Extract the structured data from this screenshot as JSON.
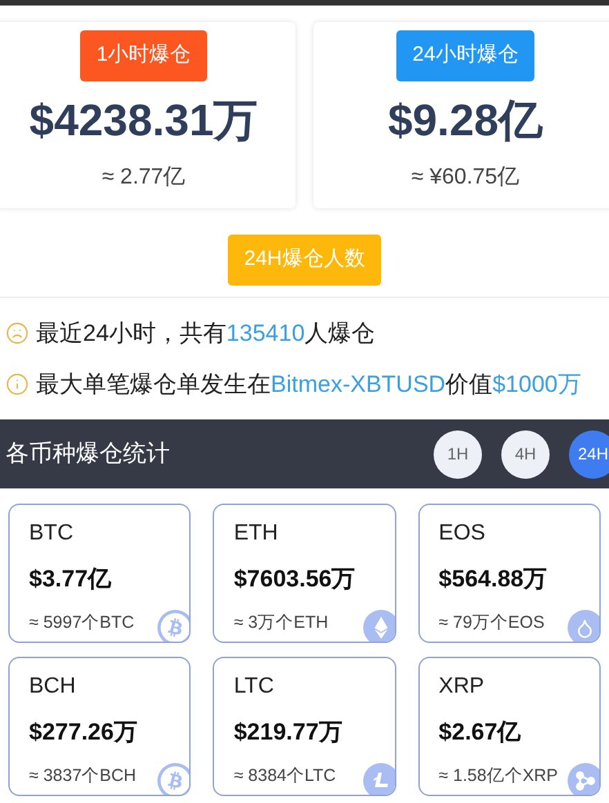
{
  "summary_cards": [
    {
      "label": "1小时爆仓",
      "color": "#fc5621",
      "value": "$4238.31万",
      "approx": "≈ 2.77亿"
    },
    {
      "label": "24小时爆仓",
      "color": "#2196f3",
      "value": "$9.28亿",
      "approx": "≈ ¥60.75亿"
    }
  ],
  "people_button": {
    "label": "24H爆仓人数"
  },
  "info_lines": [
    {
      "kind": "sad",
      "segments": [
        {
          "text": "最近24小时，共有",
          "highlight": false
        },
        {
          "text": "135410",
          "highlight": true
        },
        {
          "text": "人爆仓",
          "highlight": false
        }
      ]
    },
    {
      "kind": "info",
      "segments": [
        {
          "text": "最大单笔爆仓单发生在",
          "highlight": false
        },
        {
          "text": "Bitmex-XBTUSD",
          "highlight": true
        },
        {
          "text": "价值",
          "highlight": false
        },
        {
          "text": "$1000万",
          "highlight": true
        }
      ]
    }
  ],
  "section": {
    "title": "各币种爆仓统计",
    "periods": [
      {
        "label": "1H",
        "selected": false
      },
      {
        "label": "4H",
        "selected": false
      },
      {
        "label": "24H",
        "selected": true
      }
    ]
  },
  "coins": [
    {
      "symbol": "BTC",
      "kind": "bitcoin",
      "value": "$3.77亿",
      "approx": "≈ 5997个BTC"
    },
    {
      "symbol": "ETH",
      "kind": "ethereum",
      "value": "$7603.56万",
      "approx": "≈ 3万个ETH"
    },
    {
      "symbol": "EOS",
      "kind": "eos",
      "value": "$564.88万",
      "approx": "≈ 79万个EOS"
    },
    {
      "symbol": "BCH",
      "kind": "bitcoin",
      "value": "$277.26万",
      "approx": "≈ 3837个BCH"
    },
    {
      "symbol": "LTC",
      "kind": "litecoin",
      "value": "$219.77万",
      "approx": "≈ 8384个LTC"
    },
    {
      "symbol": "XRP",
      "kind": "ripple",
      "value": "$2.67亿",
      "approx": "≈ 1.58亿个XRP"
    }
  ]
}
